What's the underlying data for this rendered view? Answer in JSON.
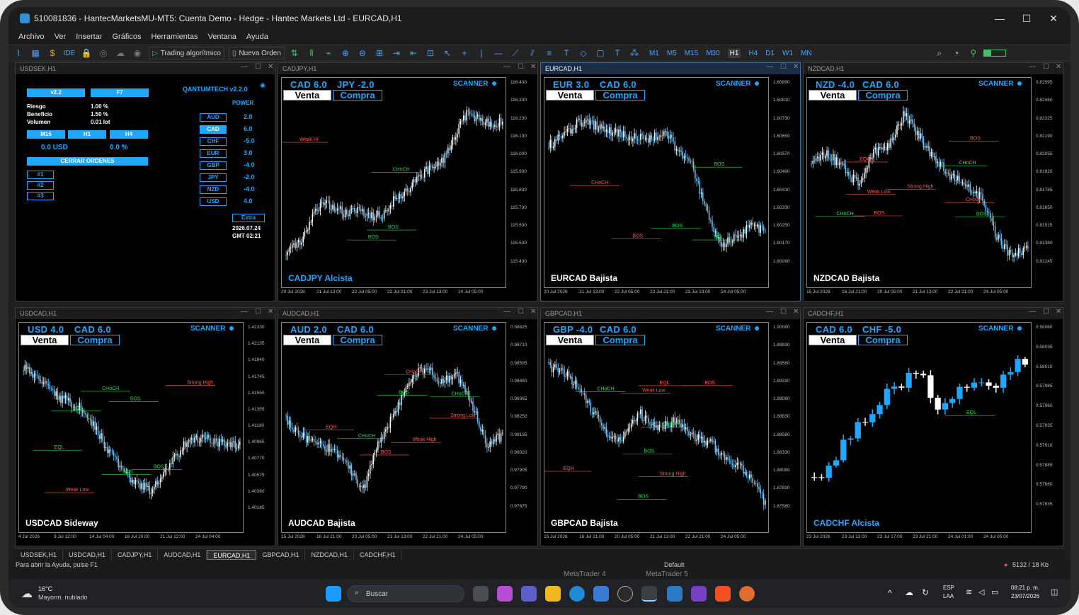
{
  "window": {
    "title": "510081836 - HantecMarketsMU-MT5: Cuenta Demo - Hedge - Hantec Markets Ltd - EURCAD,H1"
  },
  "menu": [
    "Archivo",
    "Ver",
    "Insertar",
    "Gráficos",
    "Herramientas",
    "Ventana",
    "Ayuda"
  ],
  "toolbar": {
    "ide": "IDE",
    "algo": "Trading algorítmico",
    "order": "Nueva Orden",
    "timeframes": [
      "M1",
      "M5",
      "M15",
      "M30",
      "H1",
      "H4",
      "D1",
      "W1",
      "MN"
    ],
    "active_tf": "H1"
  },
  "panel": {
    "title": "USDSEK,H1",
    "brand": "QANTUMTECH v2.2.0",
    "version": "v2.2",
    "f7": "F7",
    "riesgo_label": "Riesgo",
    "riesgo": "1.00  %",
    "beneficio_label": "Beneficio",
    "beneficio": "1.50  %",
    "volumen_label": "Volumen",
    "volumen": "0.01  lot",
    "tfs": [
      "M15",
      "H1",
      "H4"
    ],
    "usd": "0.0 USD",
    "pct": "0.0  %",
    "cerrar": "CERRAR ORDENES",
    "slots": [
      "#1",
      "#2",
      "#3"
    ],
    "power_label": "POWER",
    "power": [
      {
        "c": "AUD",
        "v": "2.0"
      },
      {
        "c": "CAD",
        "v": "6.0"
      },
      {
        "c": "CHF",
        "v": "-5.0"
      },
      {
        "c": "EUR",
        "v": "3.0"
      },
      {
        "c": "GBP",
        "v": "-4.0"
      },
      {
        "c": "JPY",
        "v": "-2.0"
      },
      {
        "c": "NZD",
        "v": "-4.0"
      },
      {
        "c": "USD",
        "v": "4.0"
      }
    ],
    "extra": "Extra",
    "date": "2026.07.24",
    "gmt": "GMT 02:21"
  },
  "charts": [
    {
      "title": "CADJPY,H1",
      "a": "CAD 6.0",
      "b": "JPY -2.0",
      "trend": "CADJPY Alcista",
      "trend_color": "#1ea7ff",
      "prices": [
        "116.430",
        "116.330",
        "116.230",
        "116.130",
        "116.030",
        "115.930",
        "115.830",
        "115.730",
        "115.630",
        "115.530",
        "115.430"
      ],
      "dates": [
        "20 Jul 2026",
        "21 Jul 13:00",
        "22 Jul 05:00",
        "22 Jul 21:00",
        "23 Jul 13:00",
        "24 Jul 05:00"
      ],
      "labels": [
        "BOS",
        "BOS",
        "CHoCH",
        "Weak Hi"
      ]
    },
    {
      "title": "EURCAD,H1",
      "a": "EUR 3.0",
      "b": "CAD 6.0",
      "trend": "EURCAD Bajista",
      "trend_color": "#ffffff",
      "prices": [
        "1.60890",
        "1.60810",
        "1.60730",
        "1.60650",
        "1.60570",
        "1.60490",
        "1.60410",
        "1.60330",
        "1.60250",
        "1.60170",
        "1.60090"
      ],
      "dates": [
        "20 Jul 2026",
        "21 Jul 13:00",
        "22 Jul 05:00",
        "22 Jul 21:00",
        "23 Jul 13:00",
        "24 Jul 05:00"
      ],
      "labels": [
        "BOS",
        "CHoCH",
        "BOS",
        "BOS",
        "EQL"
      ]
    },
    {
      "title": "NZDCAD,H1",
      "a": "NZD -4.0",
      "b": "CAD 6.0",
      "trend": "NZDCAD Bajista",
      "trend_color": "#ffffff",
      "prices": [
        "0.82595",
        "0.82460",
        "0.82325",
        "0.82190",
        "0.82055",
        "0.81920",
        "0.81785",
        "0.81650",
        "0.81515",
        "0.81380",
        "0.81245"
      ],
      "dates": [
        "15 Jul 2026",
        "16 Jul 21:00",
        "20 Jul 05:00",
        "21 Jul 13:00",
        "22 Jul 21:00",
        "24 Jul 05:00"
      ],
      "labels": [
        "BOS",
        "BOS",
        "EQH",
        "CHoCH",
        "CHoCH",
        "BOS",
        "CHoCH",
        "Strong High",
        "Weak Low"
      ]
    },
    {
      "title": "USDCAD,H1",
      "a": "USD 4.0",
      "b": "CAD 6.0",
      "trend": "USDCAD Sideway",
      "trend_color": "#ffffff",
      "prices": [
        "1.42330",
        "1.42135",
        "1.41940",
        "1.41745",
        "1.41550",
        "1.41355",
        "1.41160",
        "1.40965",
        "1.40770",
        "1.40575",
        "1.40380",
        "1.40185"
      ],
      "dates": [
        "4 Jul 2026",
        "9 Jul 12:00",
        "14 Jul 04:00",
        "16 Jul 20:00",
        "21 Jul 12:00",
        "24 Jul 04:00"
      ],
      "labels": [
        "EQL",
        "BOS",
        "BOS",
        "BOS",
        "BOS",
        "CHoCH",
        "Strong High",
        "Weak Low"
      ]
    },
    {
      "title": "AUDCAD,H1",
      "a": "AUD 2.0",
      "b": "CAD 6.0",
      "trend": "AUDCAD Bajista",
      "trend_color": "#ffffff",
      "prices": [
        "0.98825",
        "0.98710",
        "0.98595",
        "0.98480",
        "0.98365",
        "0.98250",
        "0.98135",
        "0.98020",
        "0.97905",
        "0.97790",
        "0.97675"
      ],
      "dates": [
        "15 Jul 2026",
        "16 Jul 21:00",
        "20 Jul 05:00",
        "21 Jul 13:00",
        "22 Jul 21:00",
        "24 Jul 05:00"
      ],
      "labels": [
        "CHoCH",
        "EQH",
        "CHoCH",
        "CHoCH",
        "BOS",
        "BOS",
        "Weak High",
        "Strong Low"
      ]
    },
    {
      "title": "GBPCAD,H1",
      "a": "GBP -4.0",
      "b": "CAD 6.0",
      "trend": "GBPCAD Bajista",
      "trend_color": "#ffffff",
      "prices": [
        "1.90080",
        "1.89830",
        "1.89580",
        "1.89330",
        "1.89080",
        "1.88830",
        "1.88580",
        "1.88330",
        "1.88080",
        "1.87830",
        "1.87580"
      ],
      "dates": [
        "15 Jul 2026",
        "16 Jul 21:00",
        "20 Jul 05:00",
        "21 Jul 13:00",
        "22 Jul 21:00",
        "24 Jul 05:00"
      ],
      "labels": [
        "CHoCH",
        "BOS",
        "CHoCH",
        "EQH",
        "BOS",
        "EQL",
        "BOS",
        "Strong High",
        "Weak Low"
      ]
    },
    {
      "title": "CADCHF,H1",
      "a": "CAD 6.0",
      "b": "CHF -5.0",
      "trend": "CADCHF Alcista",
      "trend_color": "#1ea7ff",
      "prices": [
        "0.58060",
        "0.58035",
        "0.58010",
        "0.57985",
        "0.57960",
        "0.57935",
        "0.57910",
        "0.57885",
        "0.57860",
        "0.57835"
      ],
      "dates": [
        "23 Jul 2026",
        "23 Jul 13:00",
        "23 Jul 17:00",
        "23 Jul 21:00",
        "24 Jul 01:00",
        "24 Jul 05:00"
      ],
      "labels": [
        "EQL"
      ]
    }
  ],
  "common": {
    "venta": "Venta",
    "compra": "Compra",
    "scanner": "SCANNER"
  },
  "tabs": [
    "USDSEK,H1",
    "USDCAD,H1",
    "CADJPY,H1",
    "AUDCAD,H1",
    "EURCAD,H1",
    "GBPCAD,H1",
    "NZDCAD,H1",
    "CADCHF,H1"
  ],
  "active_tab": "EURCAD,H1",
  "status": {
    "help": "Para abrir la Ayuda, pulse F1",
    "profile": "Default",
    "traffic": "5132 / 18 Kb"
  },
  "strip": [
    "MetaTrader 4",
    "MetaTrader 5"
  ],
  "taskbar": {
    "temp": "16°C",
    "weather": "Mayorm. nublado",
    "search": "Buscar",
    "lang1": "ESP",
    "lang2": "LAA",
    "time": "08:21 p. m.",
    "date": "23/07/2026"
  }
}
